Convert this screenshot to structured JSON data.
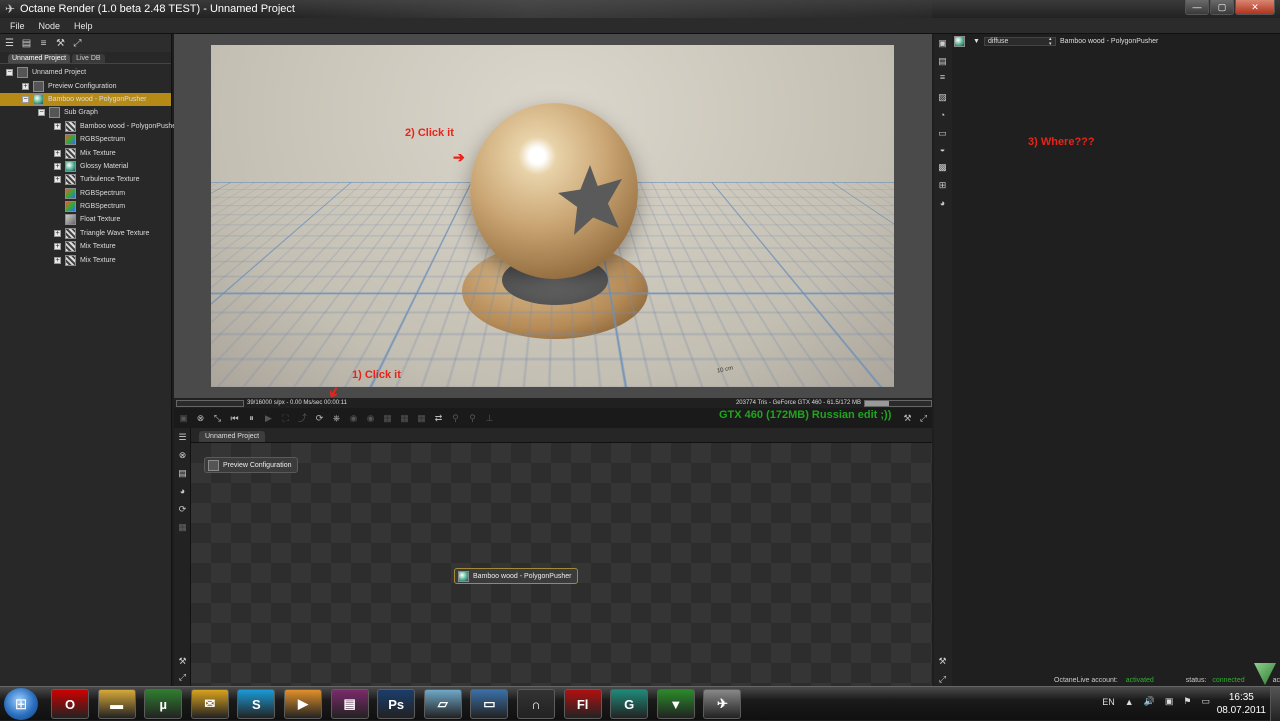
{
  "window": {
    "title": "Octane Render (1.0 beta 2.48 TEST) - Unnamed Project",
    "app_icon": "octane-icon"
  },
  "menu": [
    "File",
    "Node",
    "Help"
  ],
  "left_panel": {
    "tabs": [
      "Unnamed Project",
      "Live DB"
    ],
    "tree": [
      {
        "label": "Unnamed Project",
        "level": 0,
        "expander": "−",
        "icon": "project-icon"
      },
      {
        "label": "Preview Configuration",
        "level": 1,
        "expander": "+",
        "icon": "config-icon"
      },
      {
        "label": "Bamboo wood - PolygonPusher",
        "level": 1,
        "expander": "−",
        "icon": "material-icon",
        "selected": true
      },
      {
        "label": "Sub Graph",
        "level": 2,
        "expander": "−",
        "icon": "subgraph-icon"
      },
      {
        "label": "Bamboo wood - PolygonPusher",
        "level": 3,
        "expander": "+",
        "icon": "wave-icon"
      },
      {
        "label": "RGBSpectrum",
        "level": 3,
        "expander": "",
        "icon": "rgb-icon"
      },
      {
        "label": "Mix Texture",
        "level": 3,
        "expander": "+",
        "icon": "wave-icon"
      },
      {
        "label": "Glossy Material",
        "level": 3,
        "expander": "+",
        "icon": "material-icon"
      },
      {
        "label": "Turbulence Texture",
        "level": 3,
        "expander": "+",
        "icon": "wave-icon"
      },
      {
        "label": "RGBSpectrum",
        "level": 3,
        "expander": "",
        "icon": "rgb-icon"
      },
      {
        "label": "RGBSpectrum",
        "level": 3,
        "expander": "",
        "icon": "rgb-icon"
      },
      {
        "label": "Float Texture",
        "level": 3,
        "expander": "",
        "icon": "texture-icon"
      },
      {
        "label": "Triangle Wave Texture",
        "level": 3,
        "expander": "+",
        "icon": "wave-icon"
      },
      {
        "label": "Mix Texture",
        "level": 3,
        "expander": "+",
        "icon": "wave-icon"
      },
      {
        "label": "Mix Texture",
        "level": 3,
        "expander": "+",
        "icon": "wave-icon"
      }
    ]
  },
  "viewport": {
    "annotations": {
      "click1": "1) Click it",
      "click2": "2) Click it",
      "where": "3) Where???"
    },
    "green_note": "GTX 460 (172MB) Russian edit ;))",
    "status_left": "39/16000 s/px - 0.00 Ms/sec  00:00:11",
    "status_right": "203774 Tris - GeForce GTX 460 - 61.5/172 MB",
    "memory_fraction": 0.36,
    "scale_label": "10 cm"
  },
  "graph": {
    "tab": "Unnamed Project",
    "nodes": {
      "preview": "Preview Configuration",
      "material": "Bamboo wood - PolygonPusher"
    }
  },
  "right_panel": {
    "combo": "diffuse",
    "node_name": "Bamboo wood - PolygonPusher",
    "live_label": "OctaneLive account:",
    "live_value": "activated",
    "status_label": "status:",
    "status_value": "connected",
    "extra": "act"
  },
  "taskbar": {
    "language": "EN",
    "time": "16:35",
    "date": "08.07.2011",
    "apps": [
      "Opera",
      "Explorer",
      "uTorrent",
      "Mail",
      "Skype",
      "Media",
      "WinRAR",
      "Ps",
      "Notes",
      "Photos",
      "Curve",
      "Fl",
      "G",
      "Octane",
      "Octane2"
    ]
  }
}
